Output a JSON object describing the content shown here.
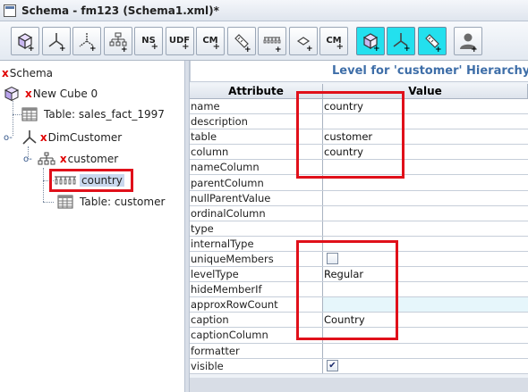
{
  "window": {
    "title": "Schema - fm123 (Schema1.xml)*"
  },
  "toolbar": {
    "buttons": [
      {
        "name": "add-cube",
        "icon": "cube-plus-icon"
      },
      {
        "name": "add-dimension",
        "icon": "dimension-plus-icon"
      },
      {
        "name": "add-dimension-usage",
        "icon": "dimension-usage-plus-icon"
      },
      {
        "name": "add-hierarchy",
        "icon": "hierarchy-plus-icon"
      },
      {
        "name": "add-named-set",
        "text": "NS"
      },
      {
        "name": "add-user-defined-function",
        "text": "UDF"
      },
      {
        "name": "add-calculated-member",
        "text": "CM"
      },
      {
        "name": "add-measure",
        "icon": "measure-plus-icon"
      },
      {
        "name": "add-level",
        "icon": "level-plus-icon"
      },
      {
        "name": "add-property",
        "icon": "property-plus-icon"
      },
      {
        "name": "add-calc-member-formula",
        "text": "CM"
      },
      {
        "name": "add-virtual-cube",
        "icon": "cube-plus-icon"
      },
      {
        "name": "add-virtual-dimension",
        "icon": "dimension-plus-icon"
      },
      {
        "name": "add-virtual-measure",
        "icon": "measure-plus-icon"
      },
      {
        "name": "add-role",
        "icon": "user-plus-icon"
      }
    ]
  },
  "tree": {
    "schema": "Schema",
    "cube": "New Cube 0",
    "fact_table": "Table: sales_fact_1997",
    "dimension": "DimCustomer",
    "hierarchy": "customer",
    "level": "country",
    "level_table": "Table: customer"
  },
  "props": {
    "header": "Level for 'customer' Hierarchy",
    "col_attribute": "Attribute",
    "col_value": "Value",
    "rows": [
      {
        "attr": "name",
        "value": "country"
      },
      {
        "attr": "description",
        "value": ""
      },
      {
        "attr": "table",
        "value": "customer"
      },
      {
        "attr": "column",
        "value": "country"
      },
      {
        "attr": "nameColumn",
        "value": ""
      },
      {
        "attr": "parentColumn",
        "value": ""
      },
      {
        "attr": "nullParentValue",
        "value": ""
      },
      {
        "attr": "ordinalColumn",
        "value": ""
      },
      {
        "attr": "type",
        "value": ""
      },
      {
        "attr": "internalType",
        "value": ""
      },
      {
        "attr": "uniqueMembers",
        "checkbox": false
      },
      {
        "attr": "levelType",
        "value": "Regular"
      },
      {
        "attr": "hideMemberIf",
        "value": ""
      },
      {
        "attr": "approxRowCount",
        "value": "",
        "highlight": true
      },
      {
        "attr": "caption",
        "value": "Country"
      },
      {
        "attr": "captionColumn",
        "value": ""
      },
      {
        "attr": "formatter",
        "value": ""
      },
      {
        "attr": "visible",
        "checkbox": true
      }
    ]
  },
  "colors": {
    "annotation_red": "#e0101a",
    "header_blue": "#3e6ea8",
    "cyan_button": "#23e0ee"
  }
}
